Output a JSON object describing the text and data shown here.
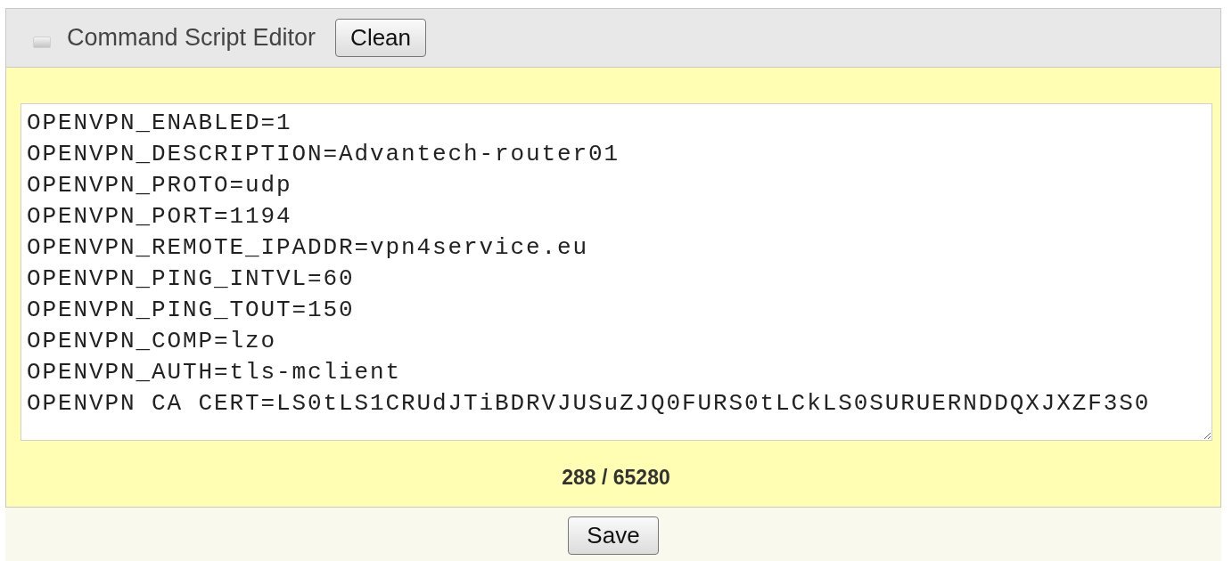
{
  "panel": {
    "title": "Command Script Editor",
    "clean_button": "Clean"
  },
  "editor": {
    "lines": [
      "OPENVPN_ENABLED=1",
      "OPENVPN_DESCRIPTION=Advantech-router01",
      "OPENVPN_PROTO=udp",
      "OPENVPN_PORT=1194",
      "OPENVPN_REMOTE_IPADDR=vpn4service.eu",
      "OPENVPN_PING_INTVL=60",
      "OPENVPN_PING_TOUT=150",
      "OPENVPN_COMP=lzo",
      "OPENVPN_AUTH=tls-mclient",
      "OPENVPN CA CERT=LS0tLS1CRUdJTiBDRVJUSuZJQ0FURS0tLCkLS0SURUERNDDQXJXZF3S0"
    ]
  },
  "counter": "288 / 65280",
  "save_button": "Save"
}
